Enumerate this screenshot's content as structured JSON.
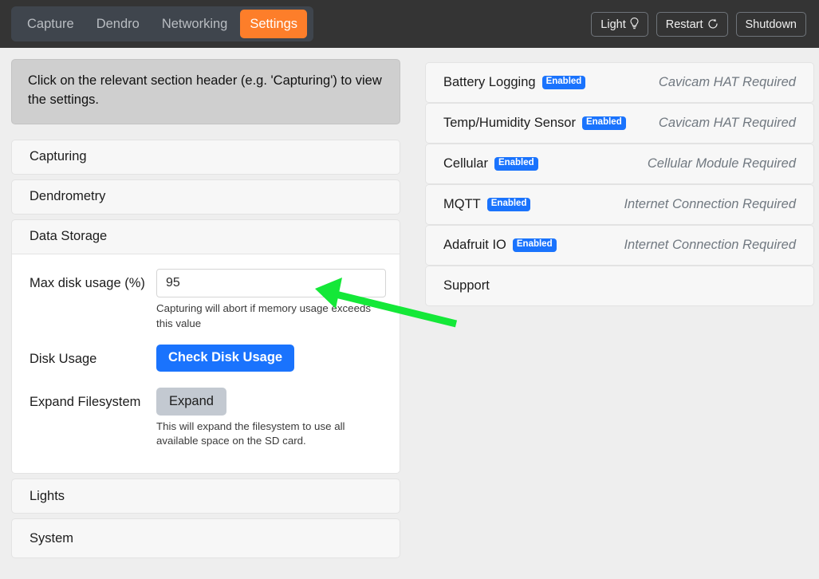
{
  "header": {
    "tabs": [
      {
        "label": "Capture",
        "active": false
      },
      {
        "label": "Dendro",
        "active": false
      },
      {
        "label": "Networking",
        "active": false
      },
      {
        "label": "Settings",
        "active": true
      }
    ],
    "actions": [
      {
        "label": "Light",
        "icon": "lightbulb-icon",
        "glyph": "Ὂ1"
      },
      {
        "label": "Restart",
        "icon": "restart-icon",
        "glyph": "↺"
      },
      {
        "label": "Shutdown",
        "icon": "",
        "glyph": ""
      }
    ]
  },
  "alert": {
    "text": "Click on the relevant section header (e.g. 'Capturing') to view the settings."
  },
  "left_sections": [
    {
      "label": "Capturing",
      "open": false
    },
    {
      "label": "Dendrometry",
      "open": false
    },
    {
      "label": "Data Storage",
      "open": true
    },
    {
      "label": "Lights",
      "open": false
    },
    {
      "label": "System",
      "open": false
    }
  ],
  "data_storage": {
    "max_disk_usage": {
      "label": "Max disk usage (%)",
      "value": "95",
      "placeholder": "",
      "help": "Capturing will abort if memory usage exceeds this value"
    },
    "disk_usage": {
      "label": "Disk Usage",
      "button_label": "Check Disk Usage"
    },
    "expand_filesystem": {
      "label": "Expand Filesystem",
      "button_label": "Expand",
      "help": "This will expand the filesystem to use all available space on the SD card."
    }
  },
  "right_sections": [
    {
      "title": "Battery Logging",
      "badge": "Enabled",
      "note": "Cavicam HAT Required"
    },
    {
      "title": "Temp/Humidity Sensor",
      "badge": "Enabled",
      "note": "Cavicam HAT Required"
    },
    {
      "title": "Cellular",
      "badge": "Enabled",
      "note": "Cellular Module Required"
    },
    {
      "title": "MQTT",
      "badge": "Enabled",
      "note": "Internet Connection Required"
    },
    {
      "title": "Adafruit IO",
      "badge": "Enabled",
      "note": "Internet Connection Required"
    },
    {
      "title": "Support",
      "badge": "",
      "note": ""
    }
  ],
  "colors": {
    "accent_orange": "#fd7e2a",
    "accent_blue": "#1a73fd",
    "header_dark": "#343434",
    "page_bg": "#eeeeee",
    "annotation_green": "#14e838"
  },
  "annotation": {
    "type": "arrow",
    "points_to": "max-disk-usage-input"
  }
}
